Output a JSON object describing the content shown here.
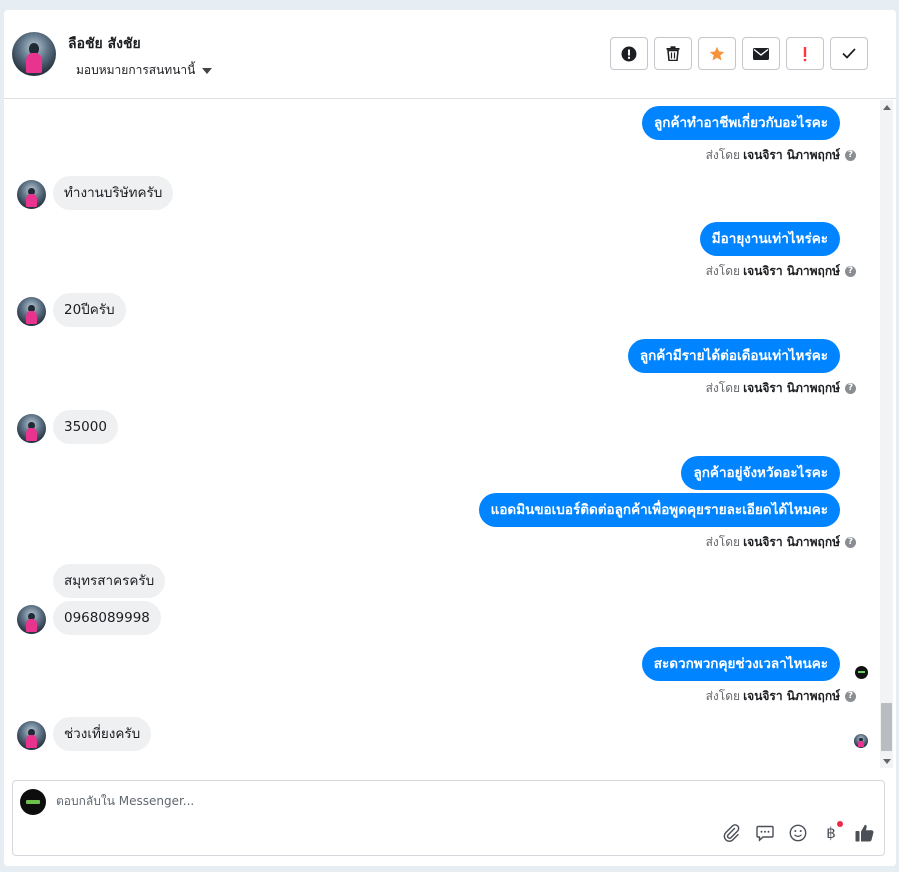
{
  "header": {
    "name": "ลือชัย สังชัย",
    "assign_label": "มอบหมายการสนทนานี้"
  },
  "toolbar": {
    "buttons": [
      {
        "icon": "alert-circle-icon"
      },
      {
        "icon": "trash-icon"
      },
      {
        "icon": "star-icon",
        "color": "#f7923a"
      },
      {
        "icon": "envelope-icon"
      },
      {
        "icon": "exclamation-icon",
        "color": "#fa383e"
      },
      {
        "icon": "checkmark-icon"
      }
    ]
  },
  "sent_by": {
    "prefix": "ส่งโดย",
    "agent": "เจนจิรา นิภาพฤกษ์"
  },
  "messages": {
    "m1": "ลูกค้าทำอาชีพเกี่ยวกับอะไรคะ",
    "m2": "ทำงานบริษัทครับ",
    "m3": "มีอายุงานเท่าไหร่คะ",
    "m4": "20ปีครับ",
    "m5": "ลูกค้ามีรายได้ต่อเดือนเท่าไหร่คะ",
    "m6": "35000",
    "m7": "ลูกค้าอยู่จังหวัดอะไรคะ",
    "m8": "แอดมินขอเบอร์ติดต่อลูกค้าเพื่อพูดคุยรายละเอียดได้ไหมคะ",
    "m9": "สมุทรสาครครับ",
    "m10": "0968089998",
    "m11": "สะดวกพวกคุยช่วงเวลาไหนคะ",
    "m12": "ช่วงเที่ยงครับ"
  },
  "composer": {
    "placeholder": "ตอบกลับใน Messenger..."
  },
  "colors": {
    "outgoing_bubble": "#0084ff",
    "incoming_bubble": "#eef0f2",
    "like_icon": "#4b4f56"
  }
}
